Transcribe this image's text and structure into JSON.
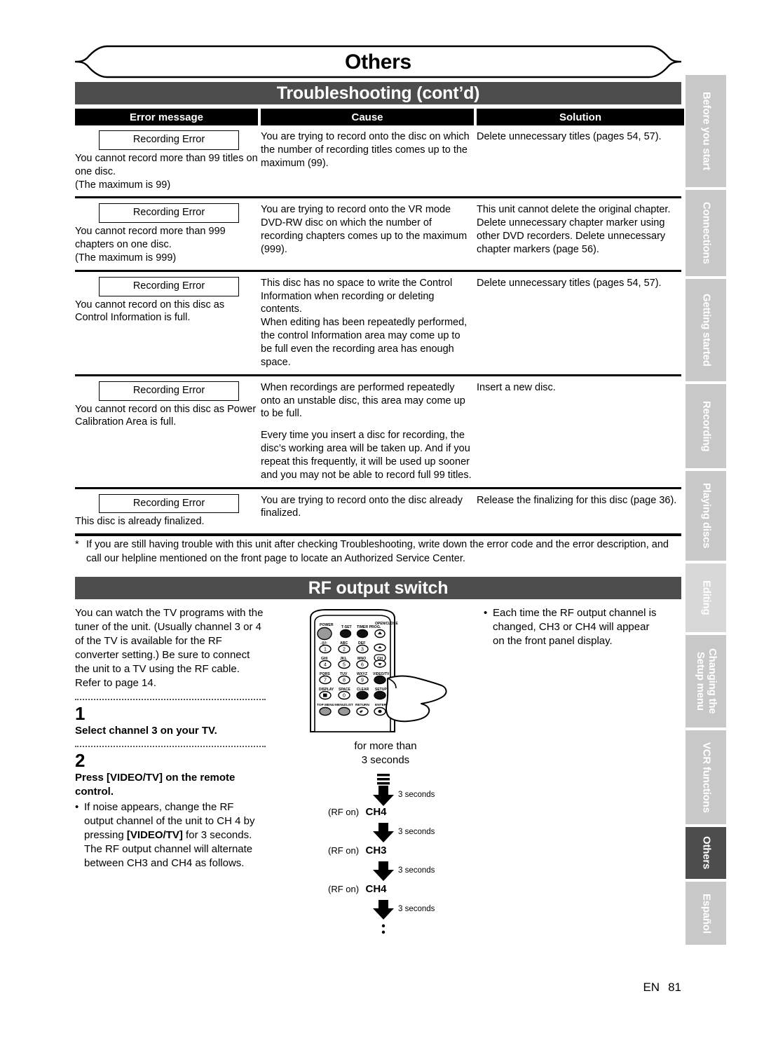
{
  "chapter_banner": "Others",
  "section_titles": {
    "troubleshooting": "Troubleshooting (cont’d)",
    "rf_output": "RF output switch"
  },
  "table": {
    "headers": [
      "Error message",
      "Cause",
      "Solution"
    ],
    "rows": [
      {
        "error_box": "Recording Error",
        "error_sub": "You cannot record more than 99 titles on one disc.\n(The maximum is 99)",
        "cause": [
          "You are trying to record onto the disc on which the number of recording titles comes up to the maximum (99)."
        ],
        "solution": [
          "Delete unnecessary titles (pages 54, 57)."
        ]
      },
      {
        "error_box": "Recording Error",
        "error_sub": "You cannot record more than 999 chapters on one disc.\n(The maximum is 999)",
        "cause": [
          "You are trying to record onto the VR mode DVD-RW disc on which the number of recording chapters comes up to the maximum (999)."
        ],
        "solution": [
          "This unit cannot delete the original chapter. Delete unnecessary chapter marker using other DVD recorders. Delete unnecessary chapter markers (page 56)."
        ]
      },
      {
        "error_box": "Recording Error",
        "error_sub": "You cannot record on this disc as Control Information is full.",
        "cause": [
          "This disc has no space to write the Control Information when recording or deleting contents.",
          "When editing has been repeatedly performed, the control Information area may come up to be full even the recording area has enough space."
        ],
        "solution": [
          "Delete unnecessary titles (pages 54, 57)."
        ]
      },
      {
        "error_box": "Recording Error",
        "error_sub": "You cannot record on this disc as Power Calibration Area is full.",
        "cause": [
          "When recordings are performed repeatedly onto an unstable disc, this area may come up to be full.",
          "Every time you insert a disc for recording, the disc’s working area will be taken up.  And if you repeat this frequently, it will be used up sooner and you may not be able to record full 99 titles."
        ],
        "solution": [
          "Insert a new disc."
        ]
      },
      {
        "error_box": "Recording Error",
        "error_sub": "This disc is already finalized.",
        "cause": [
          "You are trying to record onto the disc already finalized."
        ],
        "solution": [
          "Release the finalizing for this disc (page 36)."
        ]
      }
    ]
  },
  "footnote": {
    "marker": "*",
    "text": "If you are still having trouble with this unit after checking Troubleshooting, write down the error code and the error description, and call our helpline mentioned on the front page to locate an Authorized Service Center."
  },
  "rf": {
    "intro": "You can watch the TV programs with the tuner of the unit. (Usually channel 3 or 4 of the TV is available for the RF converter setting.) Be sure to connect the unit to a TV using the RF cable. Refer to page 14.",
    "step1_num": "1",
    "step1_head": "Select channel 3 on your TV.",
    "step2_num": "2",
    "step2_head": "Press [VIDEO/TV] on the remote control.",
    "step2_bullet_a": "If noise appears, change the RF output channel of the unit to CH 4 by pressing ",
    "step2_bullet_b": "[VIDEO/TV]",
    "step2_bullet_c": " for 3 seconds. The RF output channel will alternate between CH3 and CH4 as follows.",
    "right_bullet_dot": "•",
    "right_bullet": "Each time the RF output channel is changed, CH3 or CH4 will appear on the front panel display."
  },
  "remote": {
    "labels": {
      "power": "POWER",
      "t_set": "T-SET",
      "timer_prog": "TIMER PROG.",
      "open_close": "OPEN/CLOSE",
      "k1_top": ".@/:",
      "k1": "1",
      "k2_top": "ABC",
      "k2": "2",
      "k3_top": "DEF",
      "k3": "3",
      "k4_top": "GHI",
      "k4": "4",
      "k5_top": "JKL",
      "k5": "5",
      "k6_top": "MNO",
      "k6": "6",
      "k7_top": "PQRS",
      "k7": "7",
      "k8_top": "TUV",
      "k8": "8",
      "k9_top": "WXYZ",
      "k9": "9",
      "k0_top": "SPACE",
      "k0": "0",
      "display": "DISPLAY",
      "clear": "CLEAR",
      "setup": "SETUP",
      "videotv": "VIDEO/TV",
      "ch": "CH",
      "top_menu": "TOP MENU",
      "menulist": "MENU/LIST",
      "return": "RETURN",
      "enter": "ENTER"
    }
  },
  "flow": {
    "caption_line1": "for more than",
    "caption_line2": "3 seconds",
    "steps": [
      {
        "arrow_label": "3 seconds",
        "rf_on": "(RF on)",
        "channel": "CH4"
      },
      {
        "arrow_label": "3 seconds",
        "rf_on": "(RF on)",
        "channel": "CH3"
      },
      {
        "arrow_label": "3 seconds",
        "rf_on": "(RF on)",
        "channel": "CH4"
      },
      {
        "arrow_label": "3 seconds",
        "rf_on": "",
        "channel": ""
      }
    ],
    "ellipsis": "⋮"
  },
  "side_tabs": [
    {
      "label": "Before you start",
      "state": "inactive"
    },
    {
      "label": "Connections",
      "state": "inactive"
    },
    {
      "label": "Getting started",
      "state": "inactive"
    },
    {
      "label": "Recording",
      "state": "inactive"
    },
    {
      "label": "Playing discs",
      "state": "inactive"
    },
    {
      "label": "Editing",
      "state": "inactive"
    },
    {
      "label": "Changing the\nSetup menu",
      "state": "inactive"
    },
    {
      "label": "VCR functions",
      "state": "inactive"
    },
    {
      "label": "Others",
      "state": "active"
    },
    {
      "label": "Español",
      "state": "inactive"
    }
  ],
  "footer": {
    "lang": "EN",
    "page": "81"
  },
  "colors": {
    "section_bar": "#4d4d4d",
    "header_bar": "#000000",
    "tab_inactive": "#c8c8c8",
    "tab_active": "#4d4d4d",
    "page_bg": "#ffffff"
  }
}
